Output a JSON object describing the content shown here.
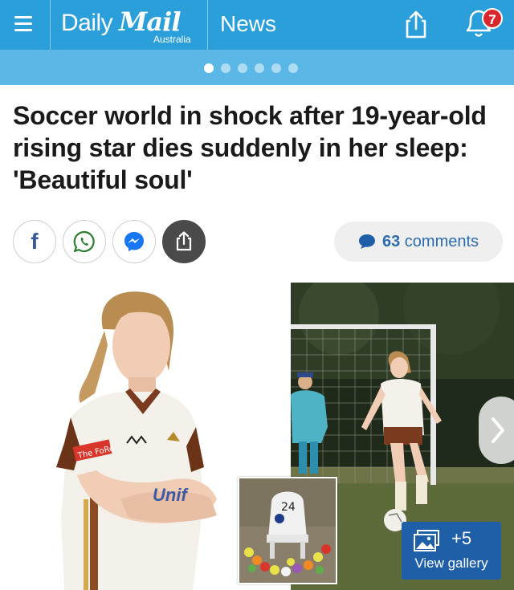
{
  "header": {
    "logo_daily": "Daily",
    "logo_mail": "Mail",
    "logo_region": "Australia",
    "section": "News",
    "notification_count": "7"
  },
  "carousel": {
    "total_dots": 6,
    "active_index": 0
  },
  "article": {
    "headline": "Soccer world in shock after 19-year-old rising star dies suddenly in her sleep: 'Beautiful soul'"
  },
  "share": {
    "facebook_glyph": "f",
    "comments_count": "63",
    "comments_label": "comments"
  },
  "images": {
    "left_jersey_text": "Unif",
    "left_sponsor_text": "The FoRe",
    "inset_number": "24"
  },
  "gallery": {
    "count": "+5",
    "label": "View gallery"
  },
  "colors": {
    "header_bg": "#2b9fd9",
    "dots_bar_bg": "#5bb8e6",
    "badge_red": "#d9262c",
    "comments_blue": "#2b6cb0",
    "gallery_blue": "#1e5fa8"
  },
  "icons": [
    "menu-icon",
    "share-icon",
    "bell-icon",
    "facebook-icon",
    "whatsapp-icon",
    "messenger-icon",
    "comment-bubble-icon",
    "chevron-right-icon",
    "gallery-icon"
  ]
}
